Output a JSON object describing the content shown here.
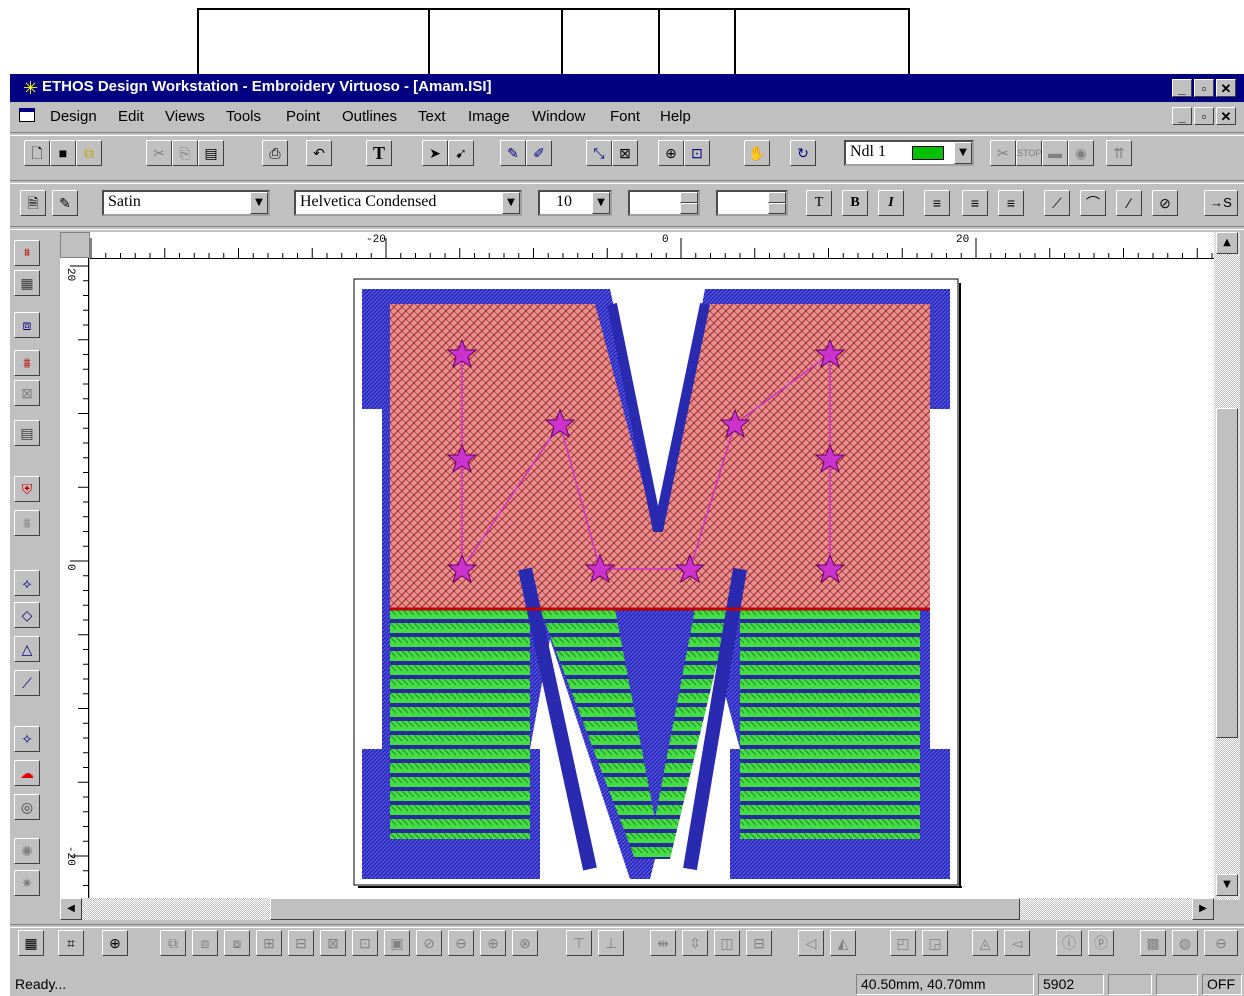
{
  "window": {
    "title": "ETHOS Design Workstation - Embroidery Virtuoso - [Amam.ISI]"
  },
  "menu": [
    "Design",
    "Edit",
    "Views",
    "Tools",
    "Point",
    "Outlines",
    "Text",
    "Image",
    "Window",
    "Font",
    "Help"
  ],
  "toolbar": {
    "needle_label": "Ndl 1",
    "needle_color": "#00c000"
  },
  "formatbar": {
    "stitch_type": "Satin",
    "font_name": "Helvetica Condensed",
    "font_size": "10",
    "bold_label": "B",
    "italic_label": "I",
    "end_label": "→S"
  },
  "ruler": {
    "h_labels": [
      "-20",
      "0",
      "20"
    ],
    "v_labels": [
      "20",
      "0",
      "-20"
    ]
  },
  "canvas": {
    "design": "M",
    "colors": {
      "fill_top": "#e07878",
      "fill_bottom": "#33cc33",
      "outline": "#1a1aa0",
      "stars": "#cc33cc"
    }
  },
  "status": {
    "message": "Ready...",
    "coords": "40.50mm, 40.70mm",
    "stitch_count": "5902",
    "mode": "OFF"
  }
}
